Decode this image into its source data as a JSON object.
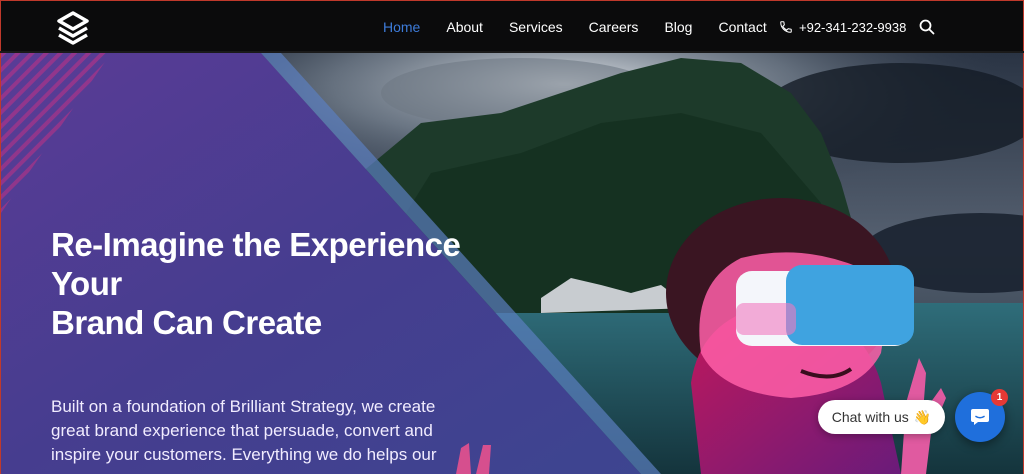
{
  "header": {
    "logo_name": "brand-logo",
    "nav": [
      {
        "label": "Home",
        "active": true
      },
      {
        "label": "About",
        "active": false
      },
      {
        "label": "Services",
        "active": false
      },
      {
        "label": "Careers",
        "active": false
      },
      {
        "label": "Blog",
        "active": false
      },
      {
        "label": "Contact",
        "active": false
      }
    ],
    "phone": "+92-341-232-9938",
    "accent_color": "#3d7bd9"
  },
  "hero": {
    "headline_line1": "Re-Imagine the Experience",
    "headline_line2": "Your",
    "headline_line3": "Brand Can Create",
    "subtext": "Built on a foundation of Brilliant Strategy, we create great brand experience that persuade, convert and inspire your customers. Everything we do helps our",
    "panel_color": "#4a3d92"
  },
  "chat": {
    "label": "Chat with us",
    "emoji": "👋",
    "badge_count": "1",
    "button_color": "#1f6fdc"
  }
}
